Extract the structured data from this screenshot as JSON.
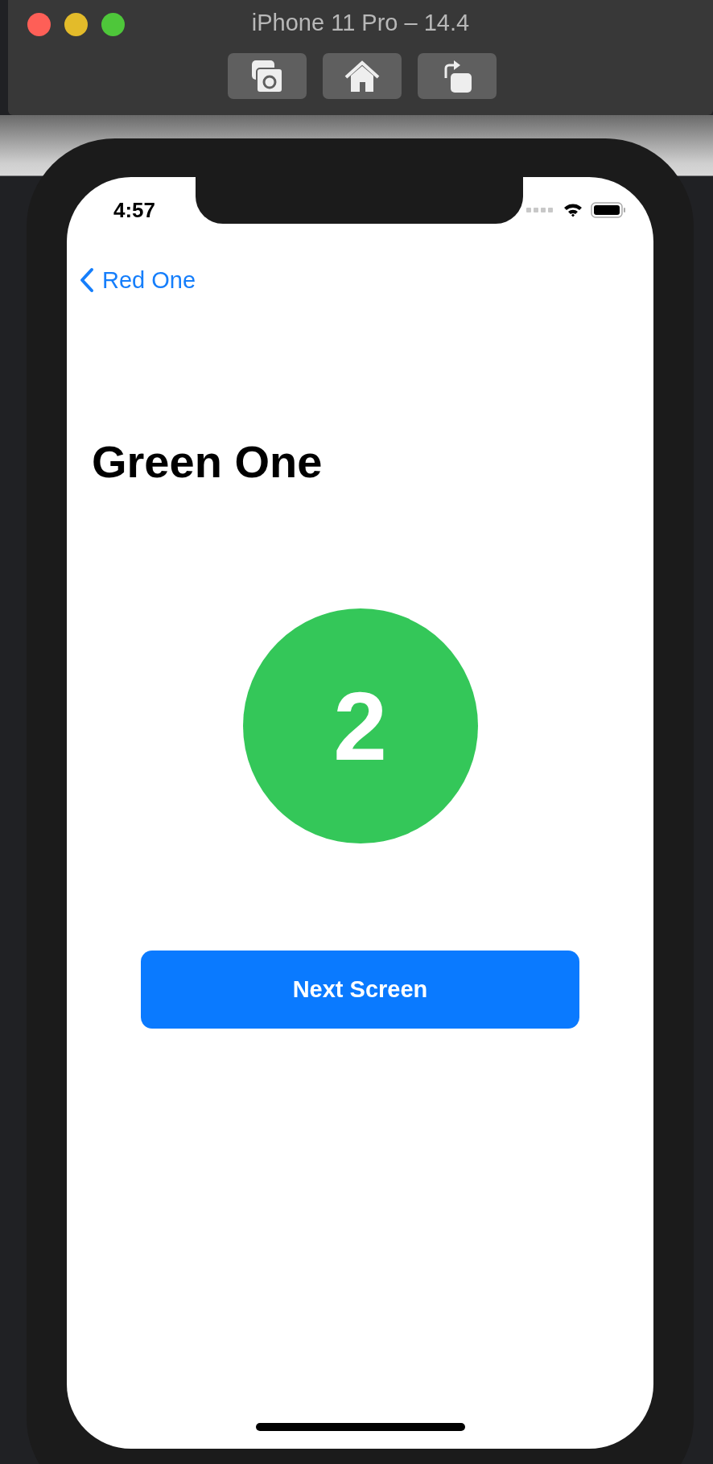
{
  "window": {
    "title": "iPhone 11 Pro – 14.4"
  },
  "status_bar": {
    "time": "4:57"
  },
  "nav": {
    "back_label": "Red One"
  },
  "title": "Green One",
  "badge": {
    "number": "2",
    "color": "#34c759"
  },
  "button": {
    "label": "Next Screen"
  }
}
